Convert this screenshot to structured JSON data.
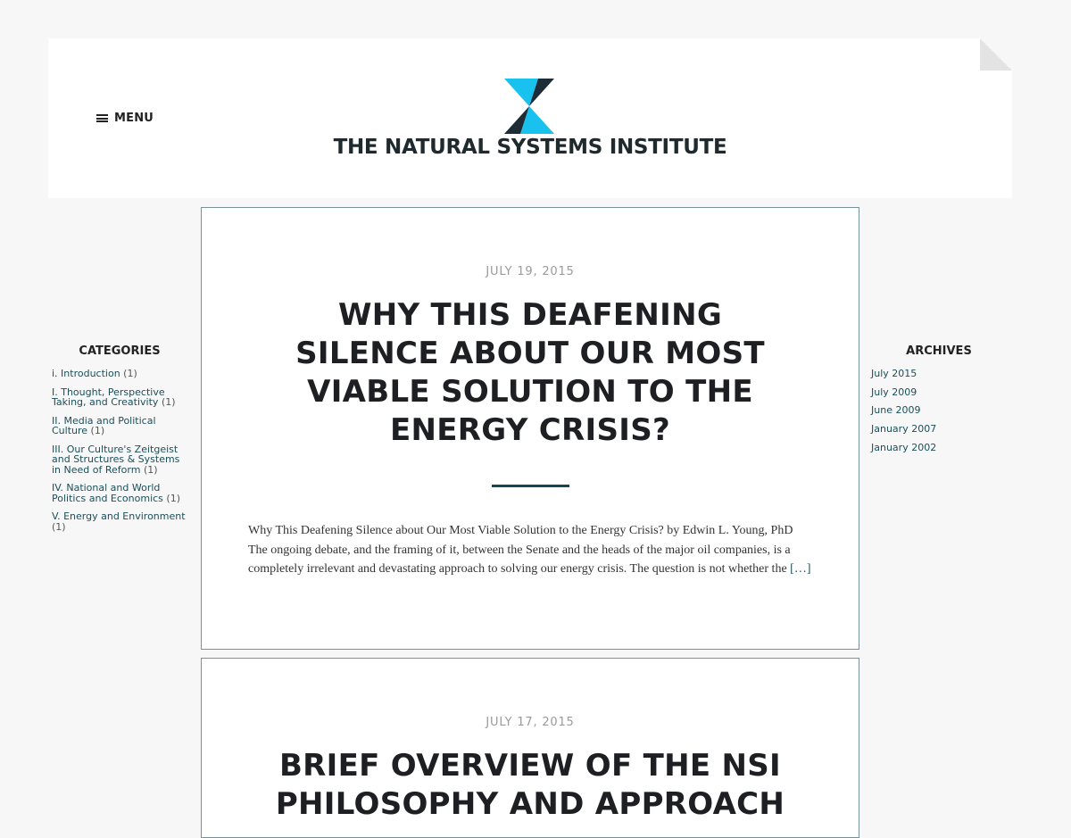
{
  "header": {
    "menu_label": "MENU",
    "site_title": "THE NATURAL SYSTEMS INSTITUTE",
    "logo_colors": {
      "light": "#19c2ee",
      "dark": "#1e2d35"
    }
  },
  "sidebar_left": {
    "title": "CATEGORIES",
    "items": [
      {
        "label": "i. Introduction",
        "count": "(1)"
      },
      {
        "label": "I. Thought, Perspective Taking, and Creativity",
        "count": "(1)"
      },
      {
        "label": "II. Media and Political Culture",
        "count": "(1)"
      },
      {
        "label": "III. Our Culture's Zeitgeist and Structures & Systems in Need of Reform",
        "count": "(1)"
      },
      {
        "label": "IV. National and World Politics and Economics",
        "count": "(1)"
      },
      {
        "label": "V. Energy and Environment",
        "count": "(1)"
      }
    ]
  },
  "sidebar_right": {
    "title": "ARCHIVES",
    "items": [
      {
        "label": "July 2015"
      },
      {
        "label": "July 2009"
      },
      {
        "label": "June 2009"
      },
      {
        "label": "January 2007"
      },
      {
        "label": "January 2002"
      }
    ]
  },
  "posts": [
    {
      "date": "JULY 19, 2015",
      "title": "WHY THIS DEAFENING SILENCE ABOUT OUR MOST VIABLE SOLUTION TO THE ENERGY CRISIS?",
      "excerpt": "Why This Deafening Silence about Our Most Viable Solution to the Energy Crisis? by Edwin L. Young, PhD The ongoing debate, and the framing of it, between the Senate and the heads of the major oil companies, is a completely irrelevant and devastating approach to solving our energy crisis. The question is not whether the",
      "read_more": "[…]"
    },
    {
      "date": "JULY 17, 2015",
      "title": "BRIEF OVERVIEW OF THE NSI PHILOSOPHY AND APPROACH"
    }
  ],
  "colors": {
    "page_background": "#f7f7f7",
    "accent": "#0d4a55",
    "link": "#1a4f5a",
    "post_border": "#7a9299"
  }
}
